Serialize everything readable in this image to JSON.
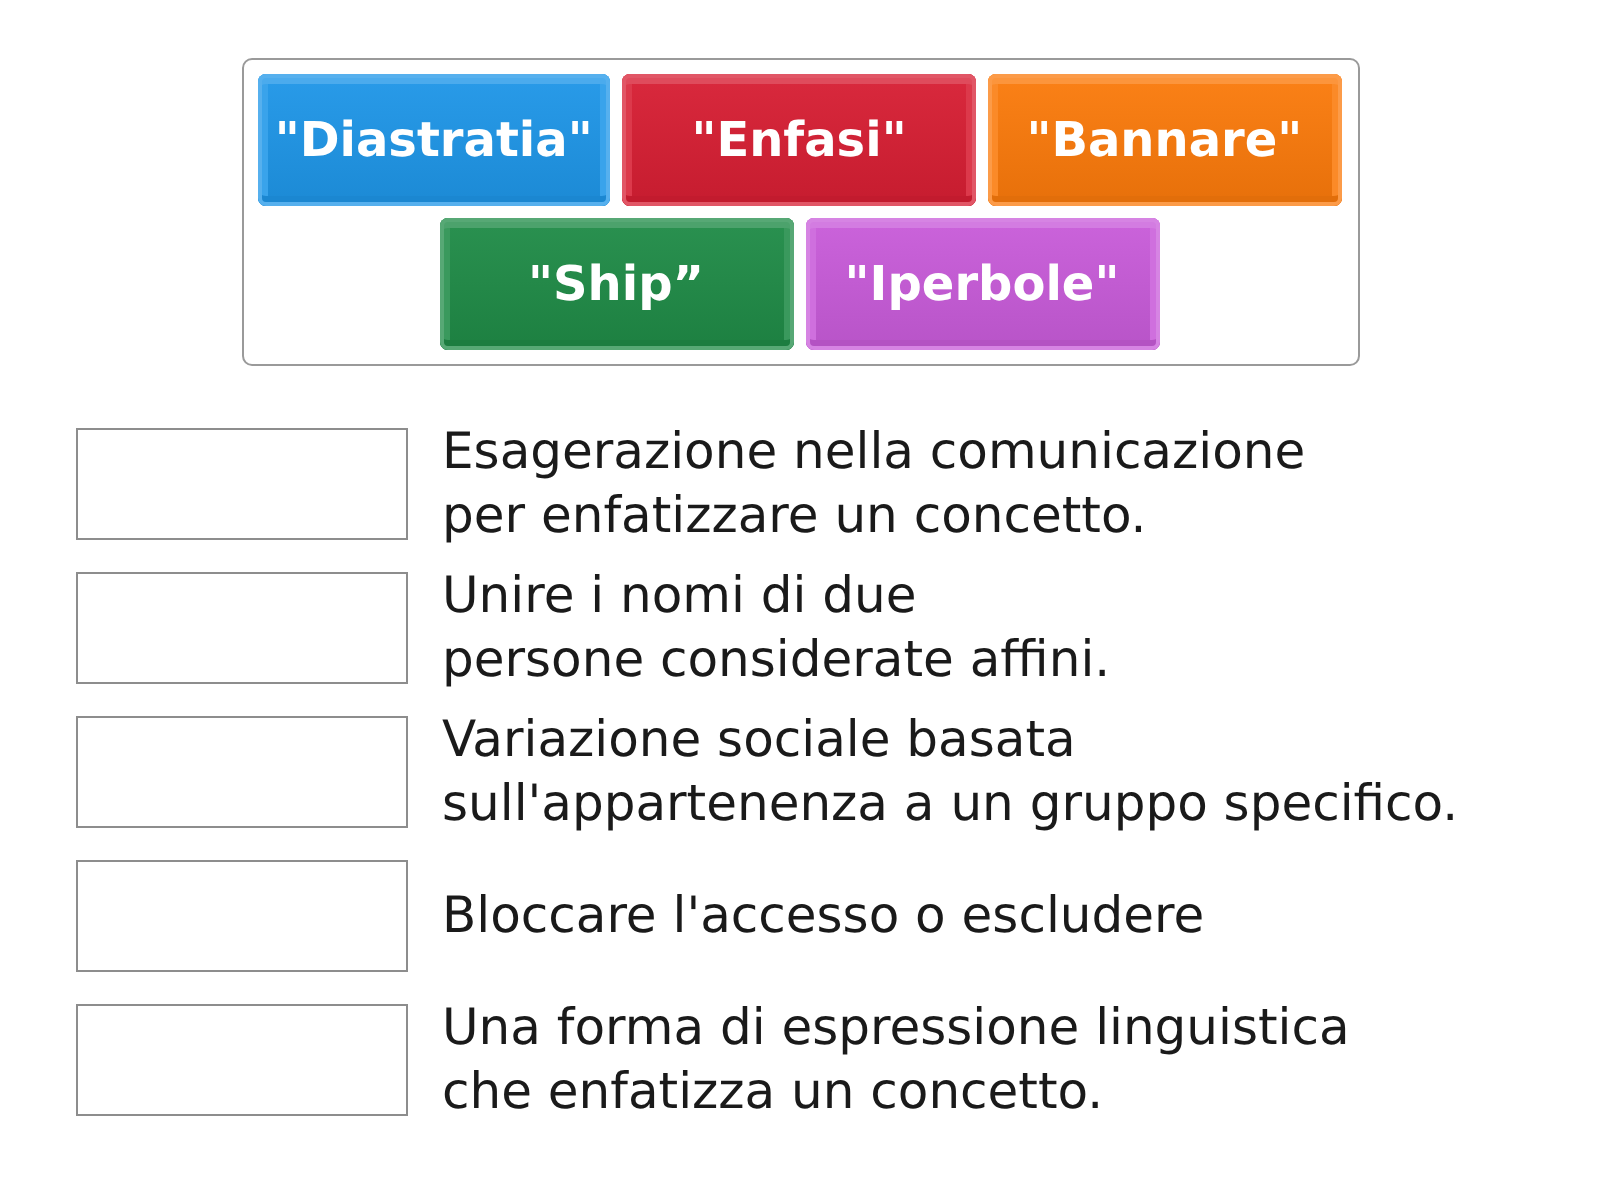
{
  "tiles": [
    {
      "label": "\"Diastratia\"",
      "color": "#1e96e8"
    },
    {
      "label": "\"Enfasi\"",
      "color": "#d71e33"
    },
    {
      "label": "\"Bannare\"",
      "color": "#fb7a0b"
    },
    {
      "label": "\"Ship”",
      "color": "#1f8b47"
    },
    {
      "label": "\"Iperbole\"",
      "color": "#c85bd9"
    }
  ],
  "items": [
    {
      "clue": "Esagerazione nella comunicazione\nper enfatizzare un concetto."
    },
    {
      "clue": "Unire i nomi di due\npersone considerate affini."
    },
    {
      "clue": "Variazione sociale basata\nsull'appartenenza a un gruppo specifico."
    },
    {
      "clue": "Bloccare l'accesso o escludere"
    },
    {
      "clue": "Una forma di espressione linguistica\nche enfatizza un concetto."
    }
  ]
}
